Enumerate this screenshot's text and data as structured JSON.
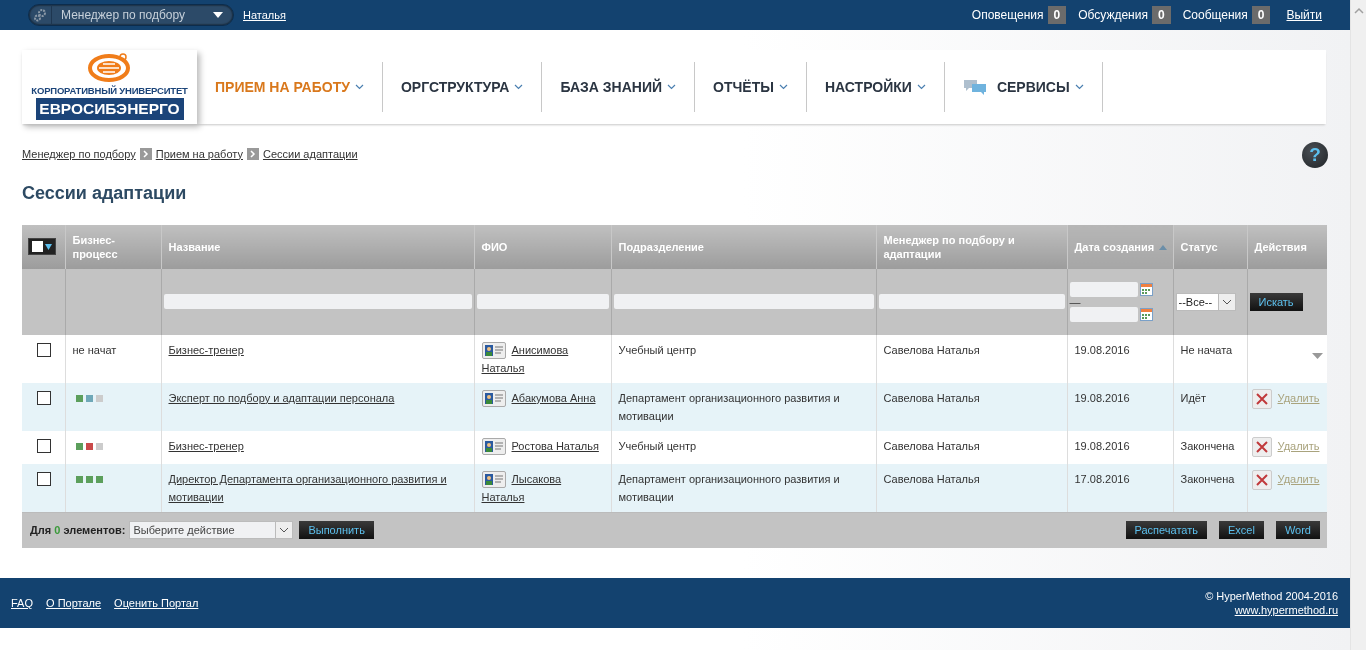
{
  "top_bar": {
    "role_select": "Менеджер по подбору",
    "user": "Наталья",
    "counters": [
      {
        "label": "Оповещения",
        "count": "0"
      },
      {
        "label": "Обсуждения",
        "count": "0"
      },
      {
        "label": "Сообщения",
        "count": "0"
      }
    ],
    "logout": "Выйти"
  },
  "logo": {
    "line1": "КОРПОРАТИВНЫЙ УНИВЕРСИТЕТ",
    "line2": "ЕВРОСИБЭНЕРГО"
  },
  "nav": [
    {
      "label": "ПРИЕМ НА РАБОТУ",
      "selected": true,
      "kind": "text"
    },
    {
      "label": "ОРГСТРУКТУРА",
      "selected": false,
      "kind": "text"
    },
    {
      "label": "БАЗА ЗНАНИЙ",
      "selected": false,
      "kind": "text"
    },
    {
      "label": "ОТЧЁТЫ",
      "selected": false,
      "kind": "text"
    },
    {
      "label": "НАСТРОЙКИ",
      "selected": false,
      "kind": "text"
    },
    {
      "label": "СЕРВИСЫ",
      "selected": false,
      "kind": "chat"
    }
  ],
  "breadcrumbs": [
    "Менеджер по подбору",
    "Прием на работу",
    "Сессии адаптации"
  ],
  "help": "?",
  "page_title": "Сессии адаптации",
  "table": {
    "select_all_checked": false,
    "columns": [
      {
        "label": "Бизнес-процесс",
        "sorted": false
      },
      {
        "label": "Название",
        "sorted": false,
        "filter": {
          "kind": "text"
        }
      },
      {
        "label": "ФИО",
        "sorted": false,
        "filter": {
          "kind": "text"
        }
      },
      {
        "label": "Подразделение",
        "sorted": false,
        "filter": {
          "kind": "text"
        }
      },
      {
        "label": "Менеджер по подбору и адаптации",
        "sorted": false,
        "filter": {
          "kind": "text"
        }
      },
      {
        "label": "Дата создания",
        "sorted": true,
        "filter": {
          "kind": "date_range",
          "separator": "—"
        }
      },
      {
        "label": "Статус",
        "sorted": false,
        "filter": {
          "kind": "select",
          "value": "--Все--"
        }
      },
      {
        "label": "Действия",
        "sorted": false,
        "filter": {
          "kind": "button",
          "value": "Искать"
        }
      }
    ],
    "rows": [
      {
        "checked": false,
        "process": {
          "kind": "text",
          "text": "не начат"
        },
        "name": "Бизнес-тренер",
        "person": "Анисимова Наталья",
        "department": "Учебный центр",
        "manager": "Савелова Наталья",
        "date": "19.08.2016",
        "status": "Не начата",
        "action": {
          "kind": "menu"
        }
      },
      {
        "checked": false,
        "process": {
          "kind": "steps",
          "steps": [
            {
              "color": "#5c9f5c"
            },
            {
              "color": "#6fa8b8"
            },
            {
              "color": "#cccccc"
            }
          ]
        },
        "name": "Эксперт по подбору и адаптации персонала",
        "person": "Абакумова Анна",
        "department": "Департамент организационного развития и мотивации",
        "manager": "Савелова Наталья",
        "date": "19.08.2016",
        "status": "Идёт",
        "action": {
          "kind": "delete",
          "label": "Удалить"
        }
      },
      {
        "checked": false,
        "process": {
          "kind": "steps",
          "steps": [
            {
              "color": "#5c9f5c"
            },
            {
              "color": "#c94a4a"
            },
            {
              "color": "#cccccc"
            }
          ]
        },
        "name": "Бизнес-тренер",
        "person": "Ростова Наталья",
        "department": "Учебный центр",
        "manager": "Савелова Наталья",
        "date": "19.08.2016",
        "status": "Закончена",
        "action": {
          "kind": "delete",
          "label": "Удалить"
        }
      },
      {
        "checked": false,
        "process": {
          "kind": "steps",
          "steps": [
            {
              "color": "#5c9f5c"
            },
            {
              "color": "#5c9f5c"
            },
            {
              "color": "#5c9f5c"
            }
          ]
        },
        "name": "Директор Департамента организационного развития и мотивации",
        "person": "Лысакова Наталья",
        "department": "Департамент организационного развития и мотивации",
        "manager": "Савелова Наталья",
        "date": "17.08.2016",
        "status": "Закончена",
        "action": {
          "kind": "delete",
          "label": "Удалить"
        }
      }
    ],
    "footer": {
      "prefix": "Для",
      "count": "0",
      "suffix": "элементов:",
      "action_placeholder": "Выберите действие",
      "run": "Выполнить",
      "exports": [
        "Распечатать",
        "Excel",
        "Word"
      ]
    }
  },
  "page_footer": {
    "links": [
      "FAQ",
      "О Портале",
      "Оценить Портал"
    ],
    "copyright": "© HyperMethod 2004-2016",
    "site": "www.hypermethod.ru"
  }
}
